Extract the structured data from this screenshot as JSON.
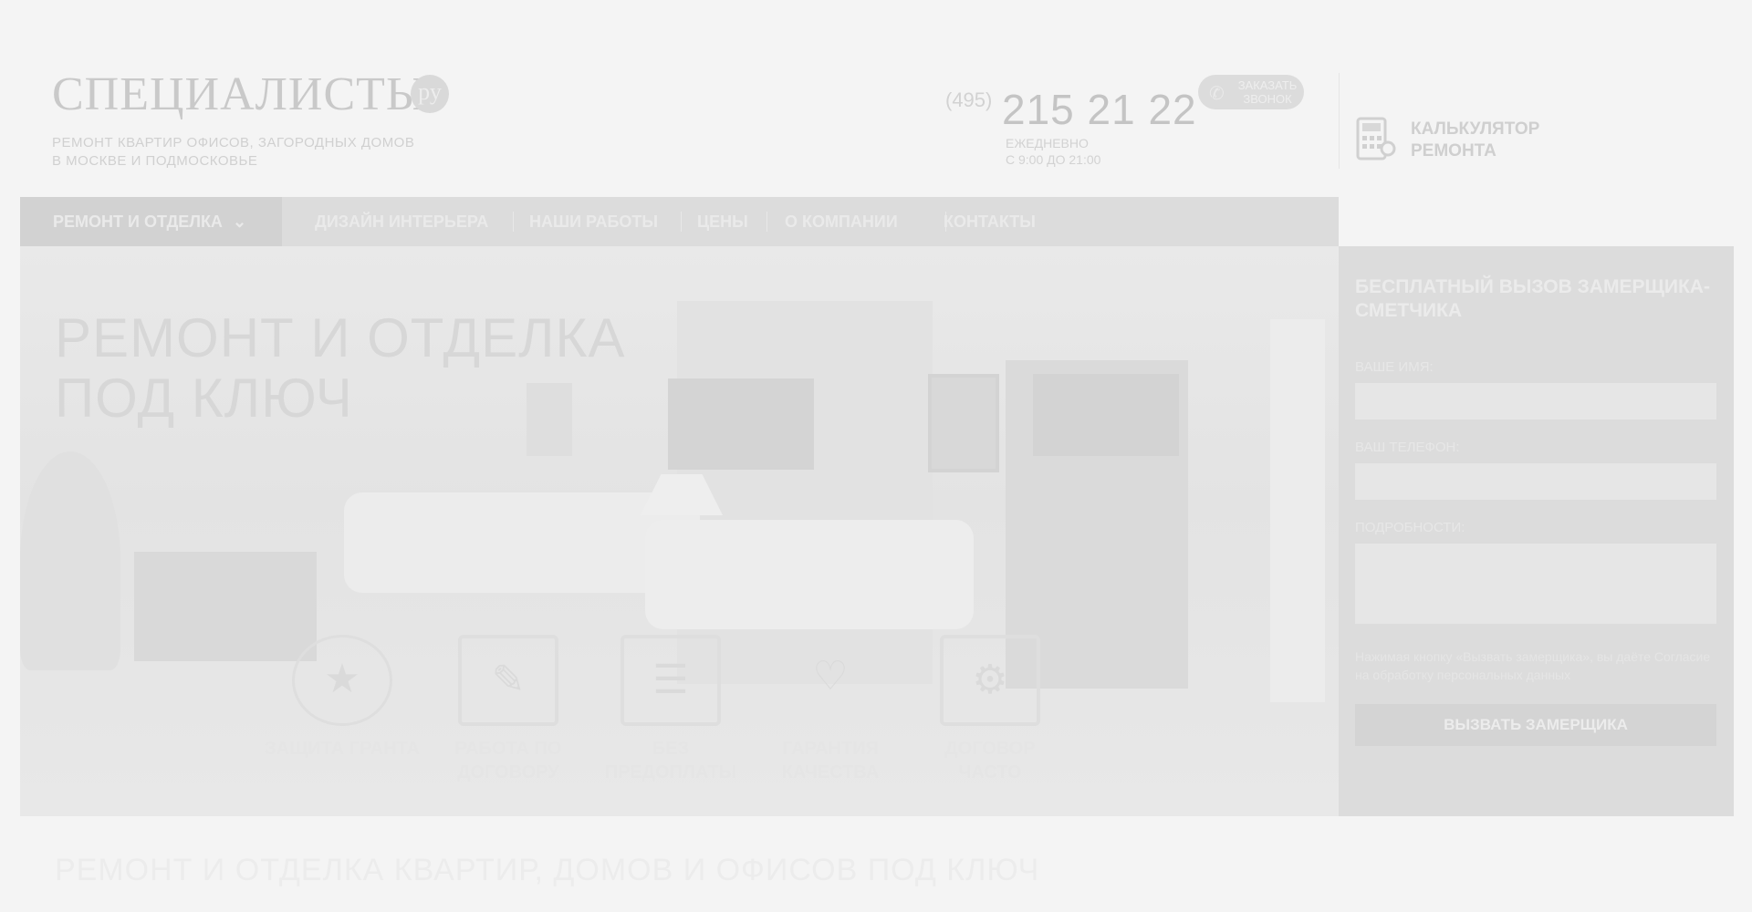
{
  "header": {
    "logo_text": "СПЕЦИАЛИСТЫ",
    "logo_badge": "ру",
    "logo_subtitle_line1": "РЕМОНТ КВАРТИР ОФИСОВ, ЗАГОРОДНЫХ ДОМОВ",
    "logo_subtitle_line2": "В МОСКВЕ И ПОДМОСКОВЬЕ",
    "phone_code": "(495)",
    "phone_number": "215 21 22",
    "callback_label": "ЗАКАЗАТЬ ЗВОНОК",
    "hours_line1": "ЕЖЕДНЕВНО",
    "hours_line2": "С 9:00 ДО 21:00",
    "calculator_label": "КАЛЬКУЛЯТОР РЕМОНТА"
  },
  "nav": {
    "items": [
      {
        "label": "РЕМОНТ И ОТДЕЛКА"
      },
      {
        "label": "ДИЗАЙН ИНТЕРЬЕРА"
      },
      {
        "label": "НАШИ РАБОТЫ"
      },
      {
        "label": "ЦЕНЫ"
      },
      {
        "label": "О КОМПАНИИ"
      },
      {
        "label": "КОНТАКТЫ"
      }
    ]
  },
  "hero": {
    "title_line1": "РЕМОНТ И ОТДЕЛКА",
    "title_line2": "ПОД КЛЮЧ",
    "features": [
      {
        "label": "ЗАЩИТА ГРАНТА",
        "icon": "laurel-star-icon"
      },
      {
        "label": "РАБОТА ПО ДОГОВОРУ",
        "icon": "contract-pen-icon"
      },
      {
        "label": "БЕЗ ПРЕДОПЛАТЫ",
        "icon": "checklist-icon"
      },
      {
        "label": "ГАРАНТИЯ КАЧЕСТВА",
        "icon": "hand-coin-icon"
      },
      {
        "label": "ДОГОВОР ЧАСТО",
        "icon": "document-gears-icon"
      }
    ]
  },
  "form": {
    "title": "БЕСПЛАТНЫЙ ВЫЗОВ ЗАМЕРЩИКА-СМЕТЧИКА",
    "name_label": "ВАШЕ ИМЯ:",
    "phone_label": "ВАШ ТЕЛЕФОН:",
    "details_label": "ПОДРОБНОСТИ:",
    "note": "Нажимая кнопку «Вызвать замерщика», вы даёте Согласие на обработку персональных данных",
    "submit_label": "ВЫЗВАТЬ ЗАМЕРЩИКА"
  },
  "section": {
    "heading": "РЕМОНТ И ОТДЕЛКА КВАРТИР, ДОМОВ И ОФИСОВ ПОД КЛЮЧ"
  },
  "colors": {
    "nav_background": "#dcdcdc",
    "page_background": "#f4f4f4"
  }
}
